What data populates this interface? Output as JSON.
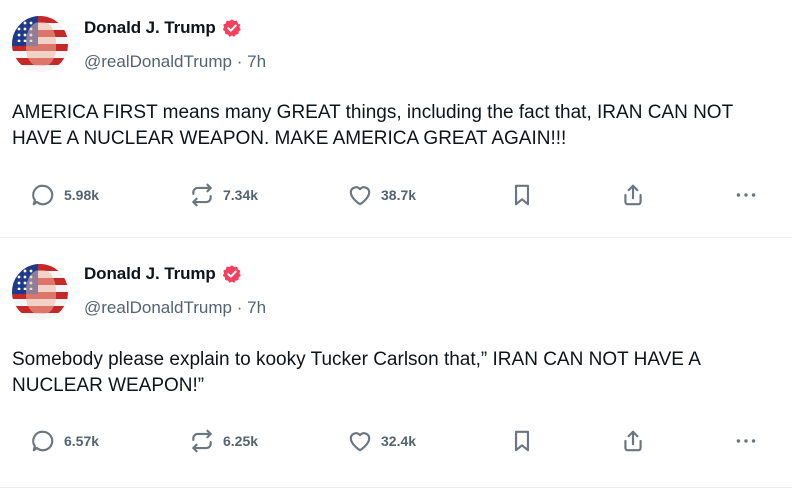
{
  "posts": [
    {
      "author": "Donald J. Trump",
      "handle": "@realDonaldTrump",
      "separator": "·",
      "time": "7h",
      "text": "AMERICA FIRST means many GREAT things, including the fact that, IRAN CAN NOT HAVE A NUCLEAR WEAPON. MAKE AMERICA GREAT AGAIN!!!",
      "replies": "5.98k",
      "reposts": "7.34k",
      "likes": "38.7k"
    },
    {
      "author": "Donald J. Trump",
      "handle": "@realDonaldTrump",
      "separator": "·",
      "time": "7h",
      "text": "Somebody please explain to kooky Tucker Carlson that,” IRAN CAN NOT HAVE A NUCLEAR WEAPON!”",
      "replies": "6.57k",
      "reposts": "6.25k",
      "likes": "32.4k"
    }
  ],
  "colors": {
    "verified_badge": "#f43f5e",
    "text_primary": "#0f1419",
    "text_secondary": "#536471",
    "divider": "#eceef0"
  },
  "icons": [
    "verified-badge-icon",
    "reply-icon",
    "repost-icon",
    "like-icon",
    "bookmark-icon",
    "share-icon",
    "more-icon"
  ]
}
